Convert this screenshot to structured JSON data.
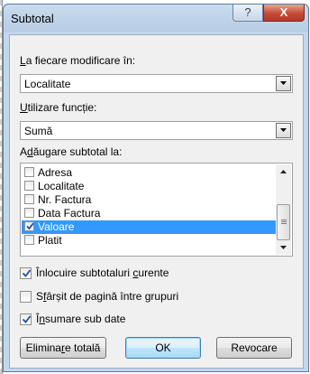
{
  "dialog": {
    "title": "Subtotal",
    "help_glyph": "?",
    "close_glyph": "X"
  },
  "group_by": {
    "label_underlined": "L",
    "label_rest": "a fiecare modificare în:",
    "selected": "Localitate"
  },
  "function": {
    "label_underlined": "U",
    "label_rest": "tilizare funcție:",
    "selected": "Sumă"
  },
  "add_subtotal": {
    "label_pre": "A",
    "label_underlined": "d",
    "label_rest": "ăugare subtotal la:",
    "items": [
      {
        "label": "Adresa",
        "checked": false,
        "selected": false
      },
      {
        "label": "Localitate",
        "checked": false,
        "selected": false
      },
      {
        "label": "Nr. Factura",
        "checked": false,
        "selected": false
      },
      {
        "label": "Data Factura",
        "checked": false,
        "selected": false
      },
      {
        "label": "Valoare",
        "checked": true,
        "selected": true
      },
      {
        "label": "Platit",
        "checked": false,
        "selected": false
      }
    ]
  },
  "options": {
    "replace_current": {
      "pre": "Înlocuire subtotaluri ",
      "underlined": "c",
      "rest": "urente",
      "checked": true
    },
    "page_break": {
      "pre": "S",
      "underlined": "f",
      "rest": "ârșit de pagină între grupuri",
      "checked": false
    },
    "summary_below": {
      "pre": "Î",
      "underlined": "n",
      "rest": "sumare sub date",
      "checked": true
    }
  },
  "buttons": {
    "remove_all": {
      "pre": "Elimina",
      "underlined": "r",
      "rest": "e totală"
    },
    "ok": "OK",
    "cancel": "Revocare"
  },
  "colors": {
    "selection": "#3399ff",
    "title_bar": "#c9dcee",
    "close_button": "#c64a35"
  }
}
